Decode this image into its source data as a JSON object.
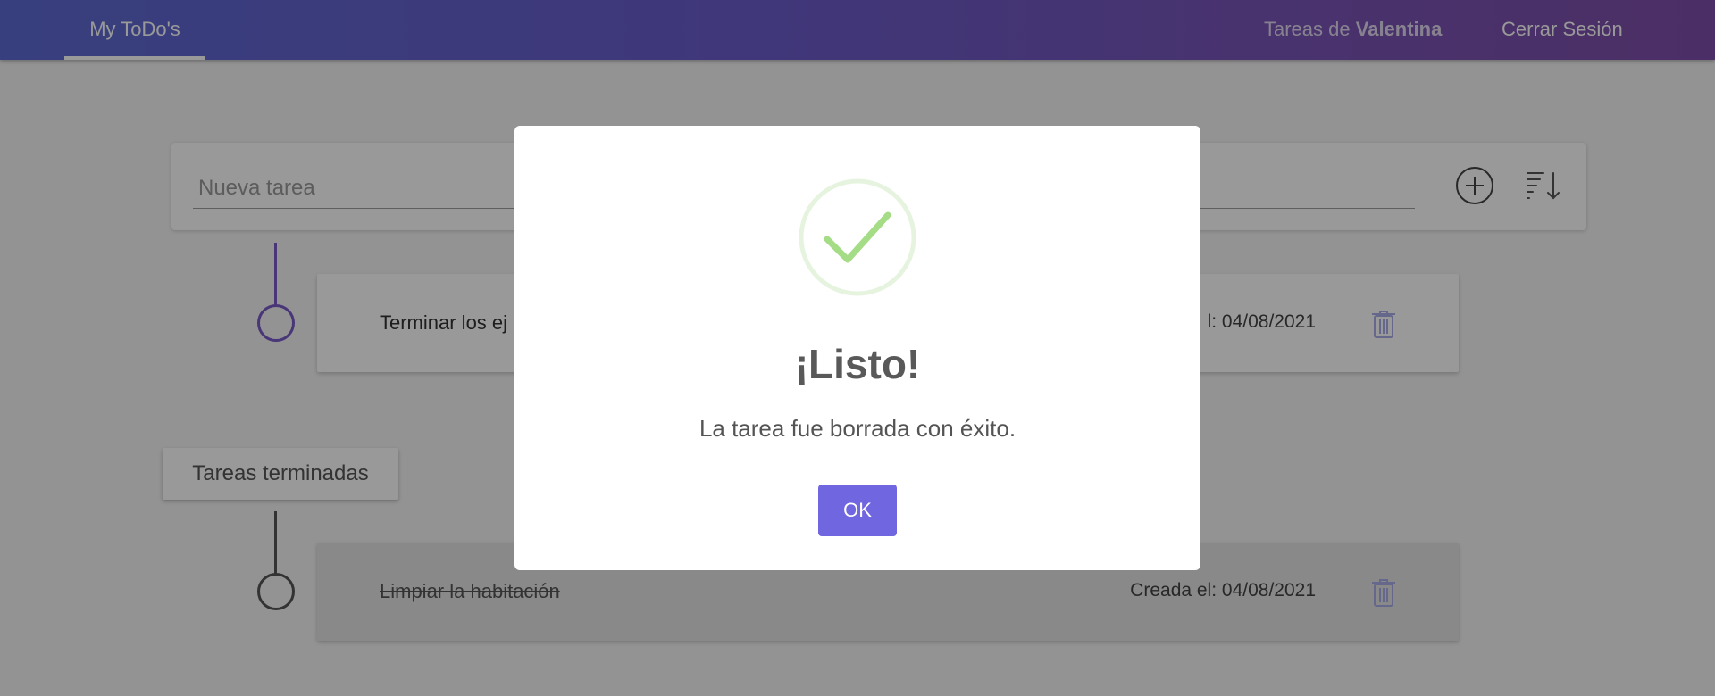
{
  "header": {
    "brand": "My ToDo's",
    "user_prefix": "Tareas de",
    "user_name": "Valentina",
    "logout": "Cerrar Sesión"
  },
  "new_task": {
    "placeholder": "Nueva tarea",
    "add_icon": "plus-circle-icon",
    "sort_icon": "sort-descending-icon"
  },
  "tasks": [
    {
      "title": "Terminar los ej",
      "date": "l: 04/08/2021",
      "done": false
    }
  ],
  "completed_section": {
    "label": "Tareas terminadas",
    "tasks": [
      {
        "title": "Limpiar la habitación",
        "date": "Creada el: 04/08/2021",
        "done": true
      }
    ]
  },
  "modal": {
    "icon": "success-check-icon",
    "title": "¡Listo!",
    "message": "La tarea fue borrada con éxito.",
    "ok_label": "OK"
  },
  "colors": {
    "header_start": "#5e6ad2",
    "header_end": "#7e4ea8",
    "timeline_active": "#7b5bc9",
    "confirm_button": "#7066e0",
    "success": "#a5dc86"
  }
}
